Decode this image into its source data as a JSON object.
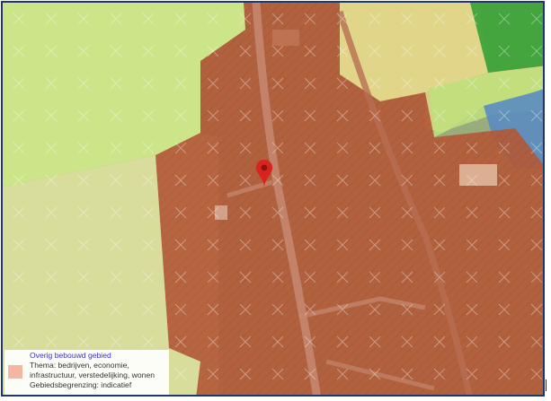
{
  "map": {
    "zones": [
      {
        "name": "overig-bebouwd-gebied",
        "color": "#b35a38"
      },
      {
        "name": "landbouw-geel",
        "color": "#e8d67a"
      },
      {
        "name": "landbouw-lichtgroen",
        "color": "#cfe889"
      },
      {
        "name": "natuur-groen",
        "color": "#3fa33a"
      },
      {
        "name": "water-blauw",
        "color": "#5b8cc0"
      }
    ],
    "marker": {
      "icon": "map-pin-icon",
      "color": "#d8241c"
    }
  },
  "legend": {
    "title": "Overig bebouwd gebied",
    "theme_line1": "Thema: bedrijven, economie,",
    "theme_line2": "infrastructuur, verstedelijking, wonen",
    "boundary": "Gebiedsbegrenzing: indicatief",
    "swatch_color": "#f4b6a0"
  }
}
